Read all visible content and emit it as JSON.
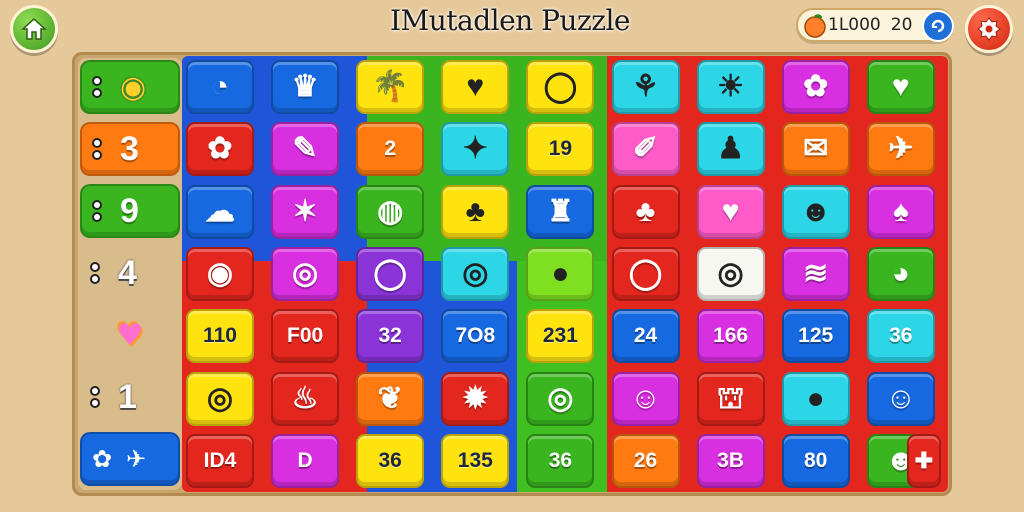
{
  "title": "IMutadlen Puzzle",
  "coins": {
    "amount": "1L000",
    "level": "20"
  },
  "icons": {
    "home": "home-icon",
    "settings": "gear-icon",
    "coin": "fruit-coin-icon",
    "add": "plus-icon"
  },
  "colors": {
    "red": "#e3261e",
    "blue": "#1669e0",
    "green": "#3ab51f",
    "yellow": "#ffe30f",
    "magenta": "#d82fe0",
    "orange": "#ff7a10",
    "cyan": "#2cd6e6",
    "lime": "#7ee020",
    "pink": "#ff5bc8",
    "purple": "#8a34d8",
    "white": "#f7f7f2",
    "gold": "#ffbd1a"
  },
  "side": [
    {
      "num": "",
      "icon": "coin-icon",
      "color": "green"
    },
    {
      "num": "3",
      "color": "orange"
    },
    {
      "num": "9",
      "color": "green"
    },
    {
      "num": "4",
      "color": ""
    },
    {
      "num": "",
      "icon": "heart-icon",
      "color": ""
    },
    {
      "num": "1",
      "color": ""
    },
    {
      "num": "",
      "icon": "sparkle-icon",
      "color": "blue"
    }
  ],
  "board": {
    "rows": [
      [
        {
          "icon": "moon-icon",
          "glyph": "◔",
          "color": "blue"
        },
        {
          "icon": "badge-icon",
          "glyph": "♛",
          "color": "blue"
        },
        {
          "icon": "palm-tree-icon",
          "glyph": "🌴",
          "color": "yellow"
        },
        {
          "icon": "apple-icon",
          "glyph": "♥",
          "color": "yellow"
        },
        {
          "icon": "ring-icon",
          "glyph": "◯",
          "color": "yellow"
        },
        {
          "icon": "twig-icon",
          "glyph": "⚘",
          "color": "cyan"
        },
        {
          "icon": "sun-icon",
          "glyph": "☀",
          "color": "cyan"
        },
        {
          "icon": "duck-icon",
          "glyph": "✿",
          "color": "magenta"
        },
        {
          "icon": "heart-shield-icon",
          "glyph": "♥",
          "color": "green"
        }
      ],
      [
        {
          "icon": "flower-icon",
          "glyph": "✿",
          "color": "red"
        },
        {
          "icon": "feather-icon",
          "glyph": "✎",
          "color": "magenta"
        },
        {
          "num": "2",
          "color": "orange"
        },
        {
          "icon": "fish-icon",
          "glyph": "✦",
          "color": "cyan"
        },
        {
          "num": "19",
          "color": "yellow",
          "light": true
        },
        {
          "icon": "carrot-icon",
          "glyph": "✐",
          "color": "pink"
        },
        {
          "icon": "wizard-icon",
          "glyph": "♟",
          "color": "cyan"
        },
        {
          "icon": "envelope-icon",
          "glyph": "✉",
          "color": "orange"
        },
        {
          "icon": "paper-plane-icon",
          "glyph": "✈",
          "color": "orange"
        }
      ],
      [
        {
          "icon": "ghost-icon",
          "glyph": "☁",
          "color": "blue"
        },
        {
          "icon": "starfish-icon",
          "glyph": "✶",
          "color": "magenta"
        },
        {
          "icon": "planet-icon",
          "glyph": "◍",
          "color": "green"
        },
        {
          "icon": "pineapple-icon",
          "glyph": "♣",
          "color": "yellow"
        },
        {
          "icon": "jar-icon",
          "glyph": "♜",
          "color": "blue"
        },
        {
          "icon": "pineapple-icon",
          "glyph": "♣",
          "color": "red"
        },
        {
          "icon": "heart-icon",
          "glyph": "♥",
          "color": "pink"
        },
        {
          "icon": "frog-icon",
          "glyph": "☻",
          "color": "cyan"
        },
        {
          "icon": "pear-icon",
          "glyph": "♠",
          "color": "magenta"
        }
      ],
      [
        {
          "icon": "leaf-coin-icon",
          "glyph": "◉",
          "color": "red"
        },
        {
          "icon": "gold-coin-icon",
          "glyph": "◎",
          "color": "magenta"
        },
        {
          "icon": "ring-icon",
          "glyph": "◯",
          "color": "purple"
        },
        {
          "icon": "gold-coin-icon",
          "glyph": "◎",
          "color": "cyan"
        },
        {
          "icon": "drumstick-icon",
          "glyph": "●",
          "color": "lime"
        },
        {
          "icon": "ring-icon",
          "glyph": "◯",
          "color": "red"
        },
        {
          "icon": "gold-coin-icon",
          "glyph": "◎",
          "color": "white"
        },
        {
          "icon": "paper-icon",
          "glyph": "≋",
          "color": "magenta"
        },
        {
          "icon": "bird-icon",
          "glyph": "◕",
          "color": "green"
        }
      ],
      [
        {
          "num": "110",
          "color": "yellow",
          "light": true
        },
        {
          "num": "F00",
          "color": "red"
        },
        {
          "num": "32",
          "color": "purple"
        },
        {
          "num": "7O8",
          "color": "blue"
        },
        {
          "num": "231",
          "color": "yellow",
          "light": true
        },
        {
          "num": "24",
          "color": "blue"
        },
        {
          "num": "166",
          "color": "magenta"
        },
        {
          "num": "125",
          "color": "blue"
        },
        {
          "num": "36",
          "color": "cyan"
        }
      ],
      [
        {
          "icon": "gold-coin-icon",
          "glyph": "◎",
          "color": "yellow"
        },
        {
          "icon": "salad-bowl-icon",
          "glyph": "♨",
          "color": "red"
        },
        {
          "icon": "leaf-icon",
          "glyph": "❦",
          "color": "orange"
        },
        {
          "icon": "gear-flower-icon",
          "glyph": "✹",
          "color": "red"
        },
        {
          "icon": "spiral-coin-icon",
          "glyph": "◎",
          "color": "green"
        },
        {
          "icon": "axolotl-icon",
          "glyph": "☺",
          "color": "magenta"
        },
        {
          "icon": "basket-icon",
          "glyph": "⛫",
          "color": "red"
        },
        {
          "icon": "chick-icon",
          "glyph": "●",
          "color": "cyan"
        },
        {
          "icon": "face-icon",
          "glyph": "☺",
          "color": "blue"
        }
      ],
      [
        {
          "num": "ID4",
          "color": "red"
        },
        {
          "num": "D",
          "color": "magenta"
        },
        {
          "num": "36",
          "color": "yellow",
          "light": true
        },
        {
          "num": "135",
          "color": "yellow",
          "light": true
        },
        {
          "num": "36",
          "color": "green"
        },
        {
          "num": "26",
          "color": "orange"
        },
        {
          "num": "3B",
          "color": "magenta"
        },
        {
          "num": "80",
          "color": "blue"
        },
        {
          "icon": "orange-fruit-icon",
          "glyph": "☻",
          "color": "green"
        }
      ]
    ],
    "corner_icon": "puzzle-piece-icon"
  }
}
